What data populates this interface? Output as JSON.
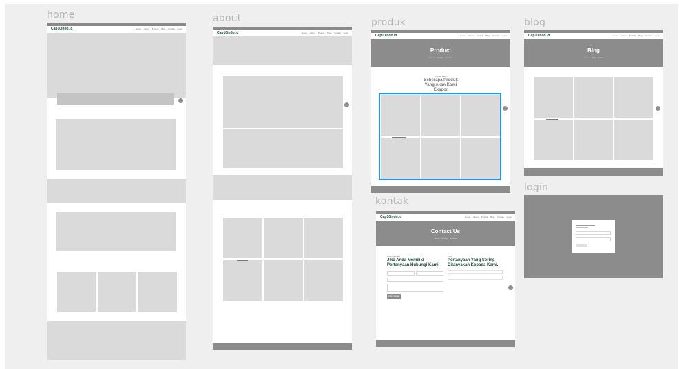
{
  "frames": {
    "home": {
      "title": "home"
    },
    "about": {
      "title": "about"
    },
    "produk": {
      "title": "produk",
      "hero_title": "Product",
      "crumb": "Home · Produk · Website",
      "eyebrow": "Produk Kami",
      "heading_line1": "Beberapa Produk",
      "heading_line2": "Yang Akan Kami",
      "heading_line3": "Ekspor"
    },
    "blog": {
      "title": "blog",
      "hero_title": "Blog",
      "crumb": "Home · Blog · Artikel"
    },
    "kontak": {
      "title": "kontak",
      "hero_title": "Contact Us",
      "crumb": "Home · Kontak · Website",
      "left_eyebrow": "Hubungi Kami",
      "left_line1": "Jika Anda Memiliki",
      "left_line2": "Pertanyaan,Hubungi Kami!",
      "right_eyebrow": "FAQ",
      "right_line1": "Pertanyaan Yang Sering",
      "right_line2": "Ditanyakan Kepada Kami.",
      "button": "Kirim Pesan"
    },
    "login": {
      "title": "login"
    }
  },
  "site": {
    "logo": "Cap10indo.id",
    "menu": [
      "Home",
      "About",
      "Produk",
      "Blog",
      "Kontak",
      "Login"
    ]
  }
}
